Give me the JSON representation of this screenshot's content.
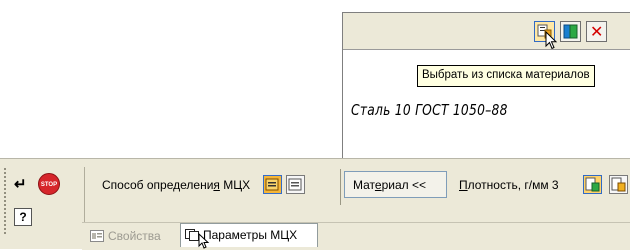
{
  "dialog": {
    "tooltip": "Выбрать из списка материалов",
    "material_text": "Сталь 10  ГОСТ 1050–88"
  },
  "panel": {
    "method_label_pre": "Способ определени",
    "method_label_u": "я",
    "method_label_post": " МЦХ",
    "stop_icon_text": "STOP",
    "help_icon_text": "?",
    "material_btn_pre": "Мат",
    "material_btn_u": "е",
    "material_btn_post": "риал  <<",
    "density_label_u": "П",
    "density_label_post": "лотность, г/мм 3",
    "tabs": [
      {
        "label": "Свойства",
        "active": false
      },
      {
        "label": "Параметры МЦХ",
        "active": true
      }
    ]
  },
  "colors": {
    "panel_bg": "#ece9d8",
    "tooltip_bg": "#ffffe1",
    "stop_red": "#d6262b",
    "close_red": "#d40000",
    "accent_blue": "#316ac5"
  },
  "icons": [
    "select-from-list-icon",
    "book-icon",
    "close-icon",
    "enter-icon",
    "stop-icon",
    "help-icon",
    "mode-icon",
    "mode-alt-icon",
    "density-icon",
    "density-alt-icon",
    "properties-tab-icon",
    "params-tab-icon",
    "mouse-cursor-icon"
  ]
}
